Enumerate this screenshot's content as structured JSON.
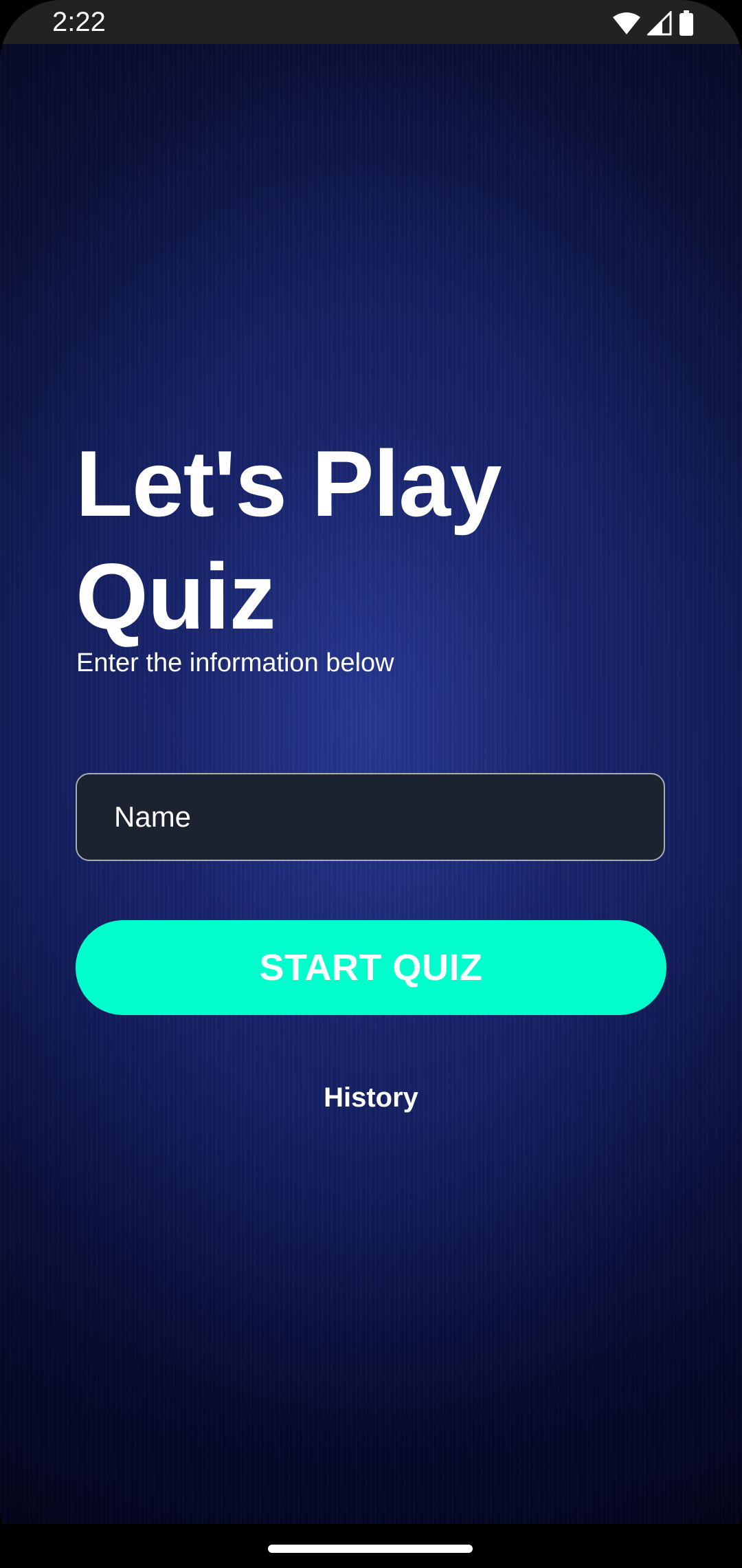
{
  "status_bar": {
    "time": "2:22",
    "icons": [
      "wifi-icon",
      "cellular-signal-icon",
      "battery-icon"
    ]
  },
  "main": {
    "title": "Let's Play Quiz",
    "subtitle": "Enter the information below",
    "name_field": {
      "placeholder": "Name",
      "value": ""
    },
    "start_button": "START QUIZ",
    "history_link": "History"
  },
  "colors": {
    "accent": "#00ffcc",
    "background": "#152168",
    "field_background": "#1b2331",
    "text": "#ffffff"
  }
}
